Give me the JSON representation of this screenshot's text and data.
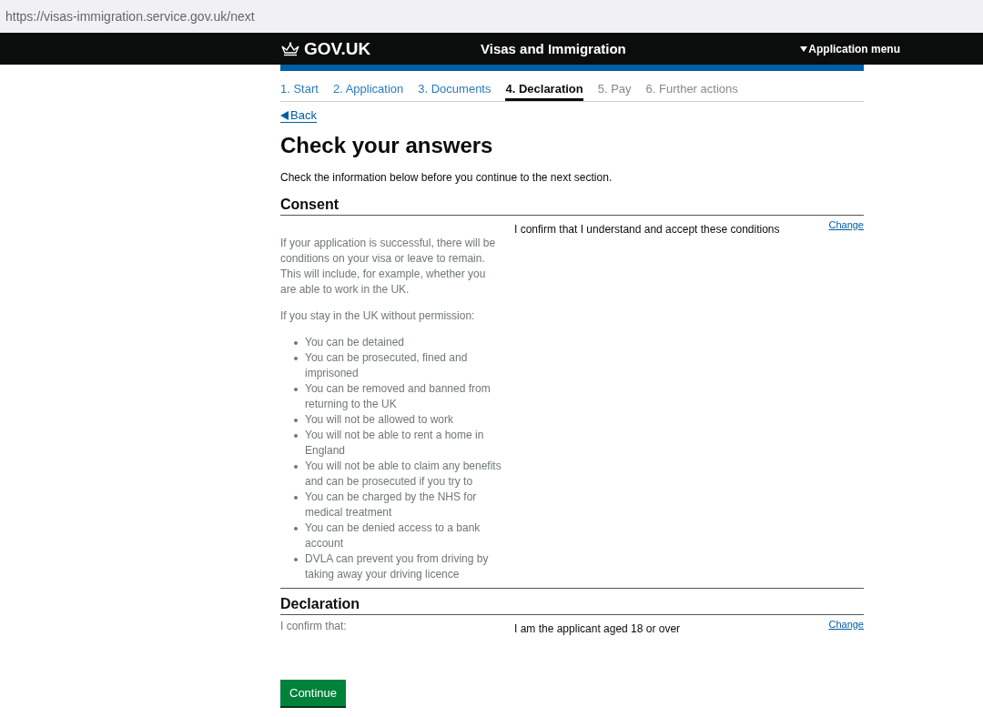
{
  "address_bar": {
    "url": "https://visas-immigration.service.gov.uk/next"
  },
  "header": {
    "logo": "GOV.UK",
    "service": "Visas and Immigration",
    "menu": "Application menu"
  },
  "steps": [
    {
      "label": "1. Start",
      "selected": false,
      "disabled": false
    },
    {
      "label": "2. Application",
      "selected": false,
      "disabled": false
    },
    {
      "label": "3. Documents",
      "selected": false,
      "disabled": false
    },
    {
      "label": "4. Declaration",
      "selected": true,
      "disabled": false
    },
    {
      "label": "5. Pay",
      "selected": false,
      "disabled": true
    },
    {
      "label": "6. Further actions",
      "selected": false,
      "disabled": true
    }
  ],
  "back_link": "Back",
  "title": "Check your answers",
  "intro": "Check the information below before you continue to the next section.",
  "sections": [
    {
      "heading": "Consent",
      "change": "Change",
      "answer": "I confirm that I understand and accept these conditions",
      "details": [
        {
          "kind": "paragraph",
          "text": "If your application is successful, there will be conditions on your visa or leave to remain. This will include, for example, whether you are able to work in the UK."
        },
        {
          "kind": "paragraph",
          "text": "If you stay in the UK without permission:"
        },
        {
          "kind": "list",
          "items": [
            "You can be detained",
            "You can be prosecuted, fined and imprisoned",
            "You can be removed and banned from returning to the UK",
            "You will not be allowed to work",
            "You will not be able to rent a home in England",
            "You will not be able to claim any benefits and can be prosecuted if you try to",
            "You can be charged by the NHS for medical treatment",
            "You can be denied access to a bank account",
            "DVLA can prevent you from driving by taking away your driving licence"
          ]
        }
      ]
    },
    {
      "heading": "Declaration",
      "change": "Change",
      "answer": "I am the applicant aged 18 or over",
      "details": [
        {
          "kind": "paragraph",
          "text": "I confirm that:"
        }
      ]
    }
  ],
  "continue_button": "Continue"
}
